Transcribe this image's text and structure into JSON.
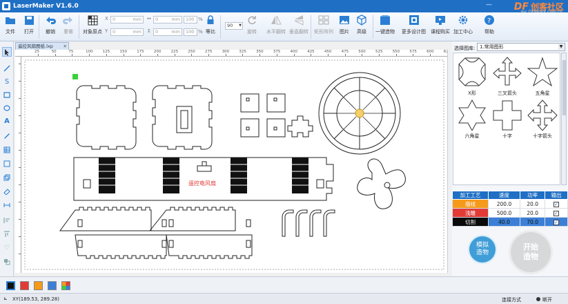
{
  "window": {
    "title": "LaserMaker V1.6.0",
    "brand_logo": "DF",
    "brand_name": "创客社区",
    "brand_url": "mc.DFRobot.com.cn"
  },
  "toolbar": {
    "file": "文件",
    "open": "打开",
    "undo": "撤销",
    "redo": "重做",
    "object_origin": "对象原点",
    "x_value": "0",
    "y_value": "0",
    "w_value": "0",
    "h_value": "0",
    "unit": "mm",
    "w_percent": "100",
    "h_percent": "100",
    "percent_sign": "%",
    "lock_ratio": "等比",
    "rotate_value": "90",
    "rotate": "旋转",
    "flip_h": "水平翻转",
    "flip_v": "垂直翻转",
    "array": "矩形阵列",
    "image": "图片",
    "advanced": "高级",
    "one_click": "一键造物",
    "more_designs": "更多设计图",
    "buy_course": "课程购买",
    "maker_center": "加工中心",
    "help": "帮助"
  },
  "document": {
    "tab_name": "遥控风扇图纸.lxp",
    "ruler_marks": [
      "25",
      "50",
      "75",
      "100",
      "125",
      "150",
      "175",
      "200",
      "225",
      "250",
      "275",
      "300",
      "325",
      "350",
      "375",
      "400",
      "425",
      "450",
      "475",
      "500",
      "525",
      "550",
      "575",
      "600",
      "625"
    ],
    "red_label": "遥控电风扇"
  },
  "library": {
    "label": "选择图库:",
    "selected": "1.常用图形",
    "shapes": [
      "X形",
      "三叉箭头",
      "五角星",
      "六角星",
      "十字",
      "十字箭头"
    ]
  },
  "process_table": {
    "headers": [
      "加工工艺",
      "速度",
      "功率",
      "输出"
    ],
    "rows": [
      {
        "name": "描线",
        "speed": "200.0",
        "power": "20.0",
        "color": "#f59a1b",
        "checked": "✓"
      },
      {
        "name": "浅雕",
        "speed": "500.0",
        "power": "20.0",
        "color": "#e23b36",
        "checked": "✓"
      },
      {
        "name": "切割",
        "speed": "40.0",
        "power": "70.0",
        "color": "#0a0a0a",
        "checked": "✓"
      }
    ]
  },
  "buttons": {
    "simulate": "模拟造物",
    "start": "开始造物"
  },
  "palette": [
    "#111111",
    "#e23b36",
    "#f59a1b",
    "#3c7fd6",
    "multicolor"
  ],
  "status": {
    "coords": "XY(189.53, 289.28)",
    "connection_label": "连接方式",
    "connection_state": "断开"
  }
}
